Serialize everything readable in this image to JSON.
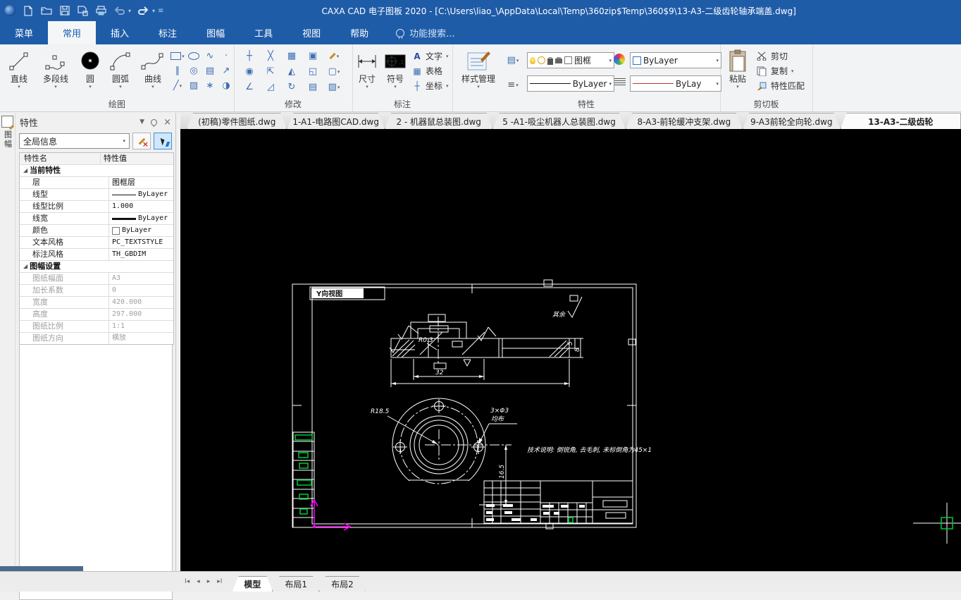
{
  "titlebar": {
    "title": "CAXA CAD 电子图板 2020 - [C:\\Users\\liao_\\AppData\\Local\\Temp\\360zip$Temp\\360$9\\13-A3-二级齿轮轴承端盖.dwg]"
  },
  "menubar": {
    "tabs": [
      {
        "label": "菜单"
      },
      {
        "label": "常用"
      },
      {
        "label": "插入"
      },
      {
        "label": "标注"
      },
      {
        "label": "图幅"
      },
      {
        "label": "工具"
      },
      {
        "label": "视图"
      },
      {
        "label": "帮助"
      }
    ],
    "active_tab": "常用",
    "search_placeholder": "功能搜索..."
  },
  "ribbon": {
    "groups": {
      "draw": {
        "label": "绘图",
        "buttons": [
          {
            "label": "直线"
          },
          {
            "label": "多段线"
          },
          {
            "label": "圆"
          },
          {
            "label": "圆弧"
          },
          {
            "label": "曲线"
          }
        ]
      },
      "modify": {
        "label": "修改"
      },
      "annotate": {
        "label": "标注",
        "big": [
          {
            "label": "尺寸"
          },
          {
            "label": "符号"
          }
        ],
        "small": [
          {
            "label": "文字"
          },
          {
            "label": "表格"
          },
          {
            "label": "坐标"
          }
        ]
      },
      "properties": {
        "label": "特性",
        "style_manager": "样式管理",
        "layer": "图框",
        "color": "ByLayer",
        "linetype": "ByLayer",
        "lineweight": "ByLay"
      },
      "clipboard": {
        "label": "剪切板",
        "paste": "粘贴",
        "cut": "剪切",
        "copy": "复制",
        "match": "特性匹配"
      }
    }
  },
  "doc_tabs": {
    "tabs": [
      {
        "label": "(初稿)零件图纸.dwg",
        "active": false
      },
      {
        "label": "1-A1-电路图CAD.dwg",
        "active": false
      },
      {
        "label": "2 - 机器鼠总装图.dwg",
        "active": false
      },
      {
        "label": "5 -A1-吸尘机器人总装图.dwg",
        "active": false
      },
      {
        "label": "8-A3-前轮缓冲支架.dwg",
        "active": false
      },
      {
        "label": "9-A3前轮全向轮.dwg",
        "active": false
      },
      {
        "label": "13-A3-二级齿轮",
        "active": true
      }
    ]
  },
  "properties_panel": {
    "title": "特性",
    "side_tab": "图幅",
    "scope": "全局信息",
    "col_name": "特性名",
    "col_value": "特性值",
    "group1": "当前特性",
    "rows1": [
      {
        "name": "层",
        "value": "图框层"
      },
      {
        "name": "线型",
        "value": "ByLayer"
      },
      {
        "name": "线型比例",
        "value": "1.000"
      },
      {
        "name": "线宽",
        "value": "ByLayer"
      },
      {
        "name": "颜色",
        "value": "ByLayer"
      },
      {
        "name": "文本风格",
        "value": "PC_TEXTSTYLE"
      },
      {
        "name": "标注风格",
        "value": "TH_GBDIM"
      }
    ],
    "group2": "图幅设置",
    "rows2": [
      {
        "name": "图纸幅面",
        "value": "A3"
      },
      {
        "name": "加长系数",
        "value": "0"
      },
      {
        "name": "宽度",
        "value": "420.000"
      },
      {
        "name": "高度",
        "value": "297.000"
      },
      {
        "name": "图纸比例",
        "value": "1:1"
      },
      {
        "name": "图纸方向",
        "value": "横放"
      }
    ]
  },
  "drawing": {
    "view_label": "Y向视图",
    "surface_note": "其余",
    "radius_label": "R0.3",
    "dim_32": "32",
    "dim_5": "5",
    "dim_8": "8",
    "radius_185": "R18.5",
    "holes_label": "3×Φ3",
    "holes_sub": "均布",
    "dim_165": "16.5",
    "tech_note": "技术说明: 倒锐角, 去毛刺, 未标倒角为45×1"
  },
  "bottom_bar": {
    "tabs": [
      {
        "label": "模型",
        "active": true
      },
      {
        "label": "布局1",
        "active": false
      },
      {
        "label": "布局2",
        "active": false
      }
    ]
  },
  "icons": {
    "caret": "▾",
    "close": "×",
    "triangle_group": "◢",
    "undo": "↶",
    "redo": "↷"
  },
  "colors": {
    "titlebar": "#1f5ca8",
    "canvas": "#000000",
    "drawing_line": "#ffffff",
    "highlight_green": "#00cc33",
    "ucs_magenta": "#ff00ff",
    "accent_blue": "#2b74c9"
  }
}
